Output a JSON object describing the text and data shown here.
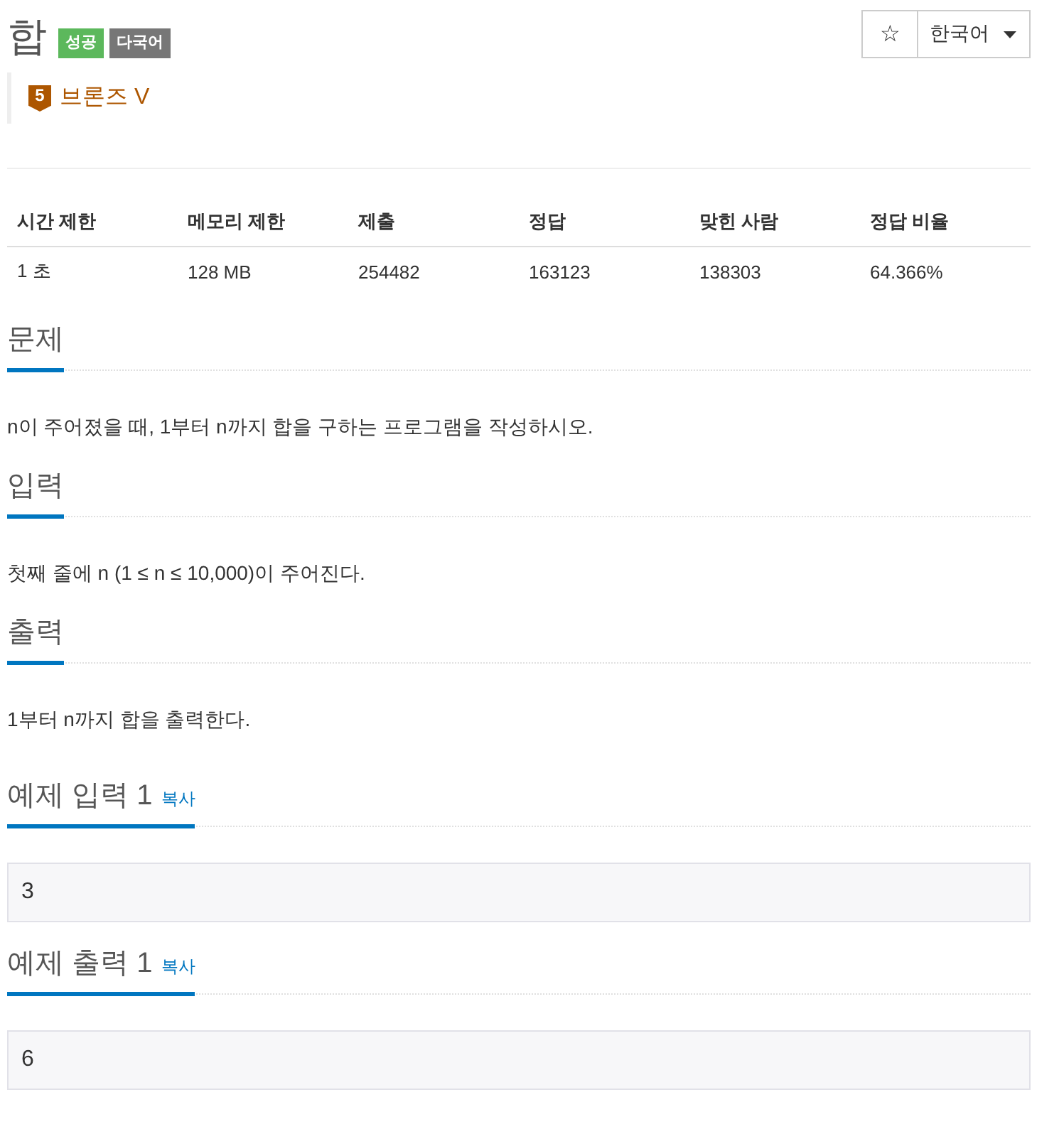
{
  "header": {
    "title": "합",
    "badges": [
      {
        "label": "성공",
        "kind": "solved"
      },
      {
        "label": "다국어",
        "kind": "multilang"
      }
    ],
    "favorite_button": {
      "label": "☆"
    },
    "language_menu": {
      "label": "한국어"
    }
  },
  "tier": {
    "number": "5",
    "label": "브론즈 V"
  },
  "stats_table": {
    "columns": [
      "시간 제한",
      "메모리 제한",
      "제출",
      "정답",
      "맞힌 사람",
      "정답 비율"
    ],
    "rows": [
      [
        "1 초",
        "128 MB",
        "254482",
        "163123",
        "138303",
        "64.366%"
      ]
    ]
  },
  "sections": [
    {
      "title": "문제",
      "body": "n이 주어졌을 때, 1부터 n까지 합을 구하는 프로그램을 작성하시오."
    },
    {
      "title": "입력",
      "body": "첫째 줄에 n (1 ≤ n ≤ 10,000)이 주어진다."
    },
    {
      "title": "출력",
      "body": "1부터 n까지 합을 출력한다."
    }
  ],
  "samples": [
    {
      "title": "예제 입력 1",
      "copy_link": "복사",
      "value": "3"
    },
    {
      "title": "예제 출력 1",
      "copy_link": "복사",
      "value": "6"
    }
  ]
}
